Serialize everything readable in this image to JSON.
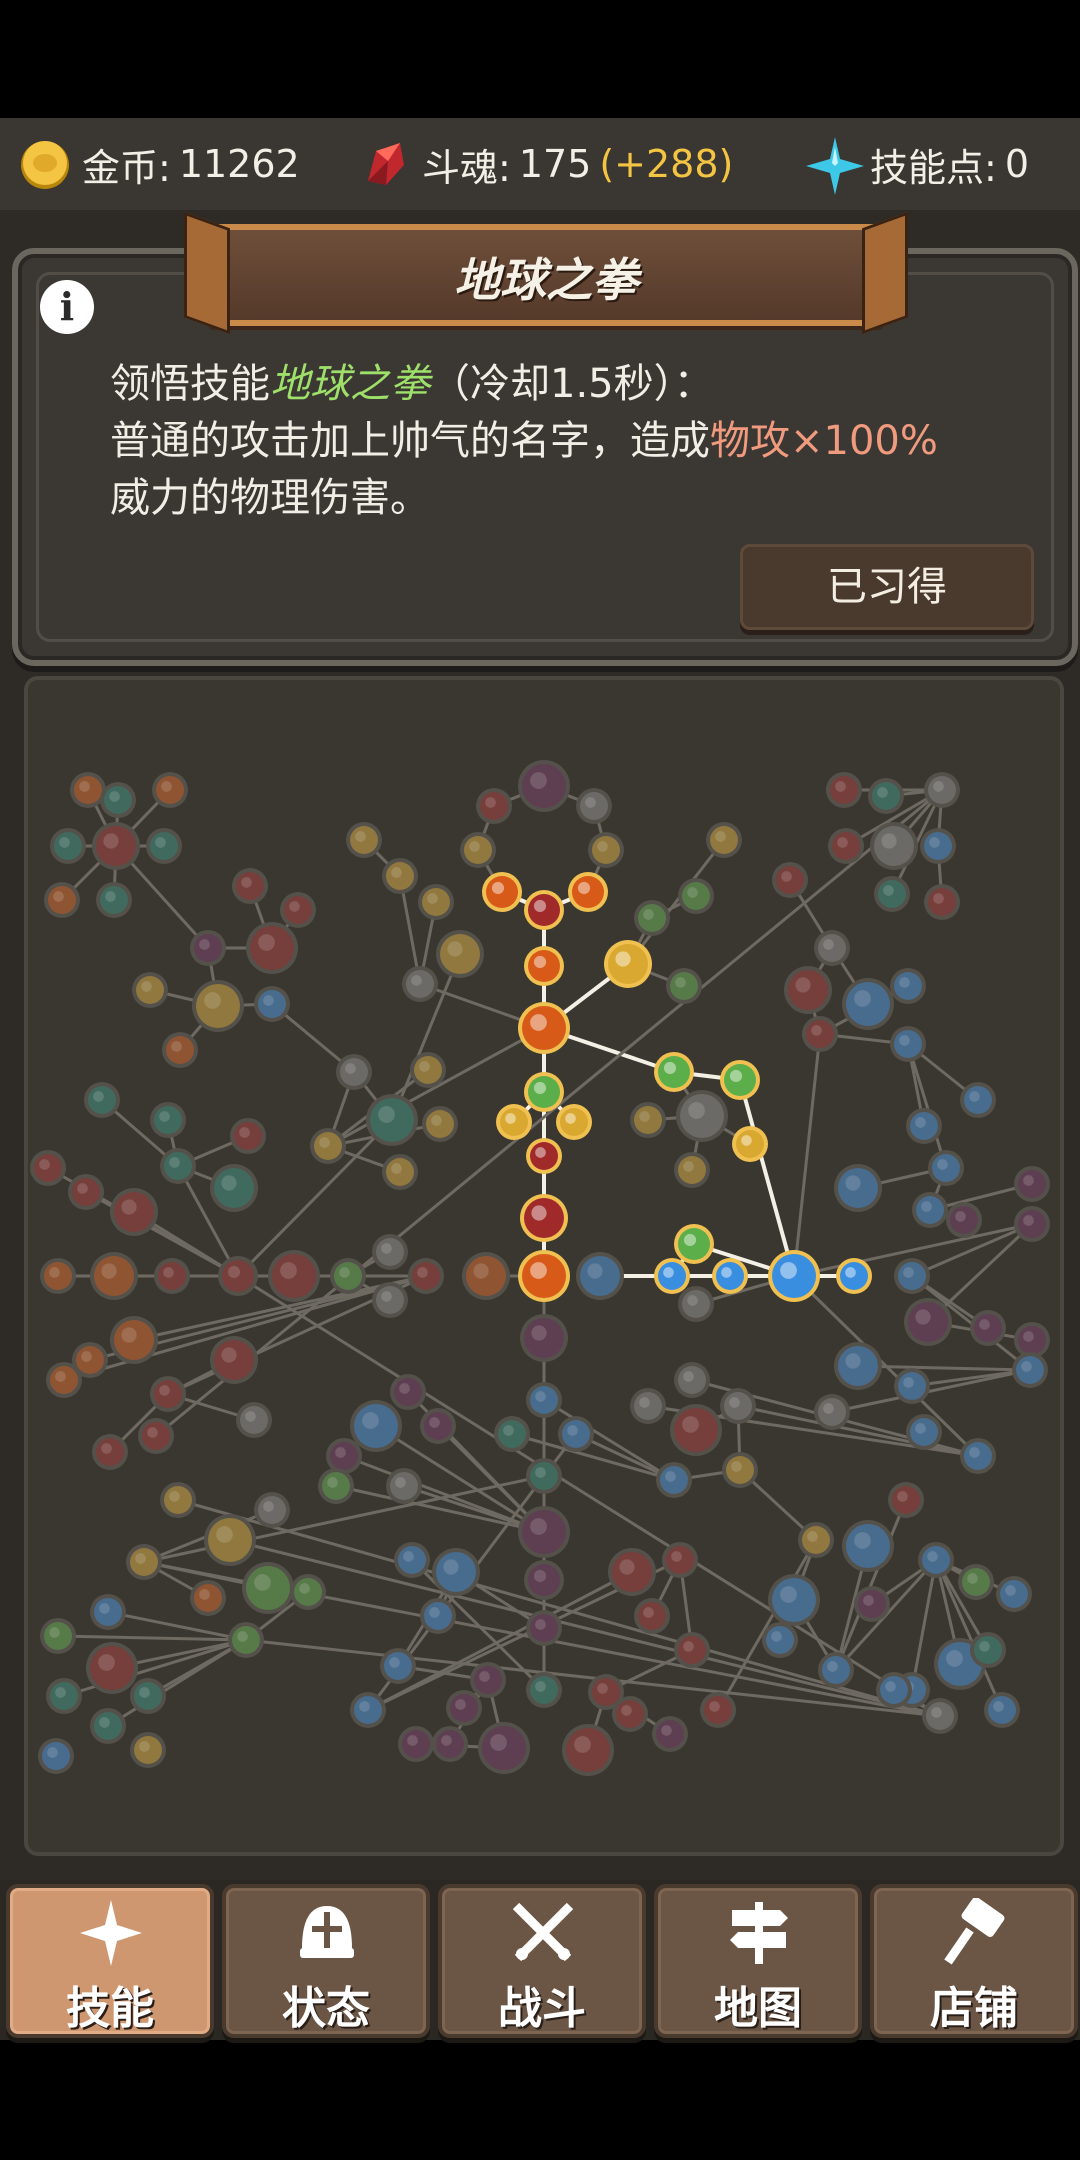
{
  "resources": {
    "gold_label": "金币:",
    "gold_value": "11262",
    "soul_label": "斗魂:",
    "soul_value": "175",
    "soul_bonus": "(+288)",
    "skill_points_label": "技能点:",
    "skill_points_value": "0"
  },
  "skill_card": {
    "title": "地球之拳",
    "desc_prefix": "领悟技能",
    "desc_skill": "地球之拳",
    "desc_cooldown": "（冷却1.5秒）：",
    "desc_line2a": "普通的攻击加上帅气的名字，造成",
    "desc_line2b": "物攻×100%",
    "desc_line3": "威力的物理伤害。",
    "learned_button": "已习得"
  },
  "nav": {
    "items": [
      {
        "label": "技能",
        "icon": "sparkle-icon",
        "active": true
      },
      {
        "label": "状态",
        "icon": "helmet-icon",
        "active": false
      },
      {
        "label": "战斗",
        "icon": "crossed-swords-icon",
        "active": false
      },
      {
        "label": "地图",
        "icon": "signpost-icon",
        "active": false
      },
      {
        "label": "店铺",
        "icon": "hammer-icon",
        "active": false
      }
    ]
  },
  "colors": {
    "fire": "#d85a18",
    "holy": "#d9a830",
    "nature": "#5cae4a",
    "ice": "#3a8ee0",
    "dark": "#6a2a5a",
    "steel": "#8a8a8a",
    "teal": "#2a8a7a",
    "blood": "#a02a2a"
  }
}
